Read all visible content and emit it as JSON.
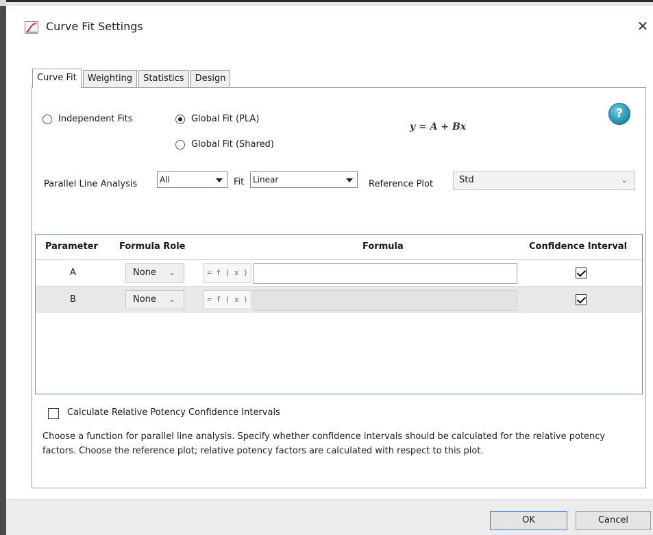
{
  "window": {
    "title": "Curve Fit Settings",
    "close_glyph": "✕",
    "icon": "curve-chart-icon"
  },
  "tabs": [
    {
      "label": "Curve Fit",
      "active": true
    },
    {
      "label": "Weighting",
      "active": false
    },
    {
      "label": "Statistics",
      "active": false
    },
    {
      "label": "Design",
      "active": false
    }
  ],
  "fit_mode": {
    "independent": {
      "label": "Independent Fits",
      "checked": false
    },
    "global_pla": {
      "label": "Global Fit (PLA)",
      "checked": true
    },
    "global_shared": {
      "label": "Global Fit (Shared)",
      "checked": false
    }
  },
  "equation": "y = A + Bx",
  "help": {
    "glyph": "?"
  },
  "pla": {
    "label": "Parallel Line Analysis",
    "value": "All",
    "fit_label": "Fit",
    "fit_value": "Linear",
    "reference_label": "Reference Plot",
    "reference_value": "Std",
    "chevron": "⌄"
  },
  "grid": {
    "headers": {
      "parameter": "Parameter",
      "formula_role": "Formula Role",
      "formula": "Formula",
      "confidence": "Confidence Interval"
    },
    "rows": [
      {
        "parameter": "A",
        "role": "None",
        "fx": "= f ( x )",
        "formula": "",
        "confidence": true
      },
      {
        "parameter": "B",
        "role": "None",
        "fx": "= f ( x )",
        "formula": "",
        "confidence": true
      }
    ]
  },
  "relative_potency": {
    "label": "Calculate Relative Potency Confidence Intervals",
    "checked": false
  },
  "description": "Choose a function for parallel line analysis. Specify whether confidence intervals should be calculated for the relative potency factors. Choose the reference plot; relative potency factors are calculated with respect to this plot.",
  "buttons": {
    "ok": "OK",
    "cancel": "Cancel"
  }
}
